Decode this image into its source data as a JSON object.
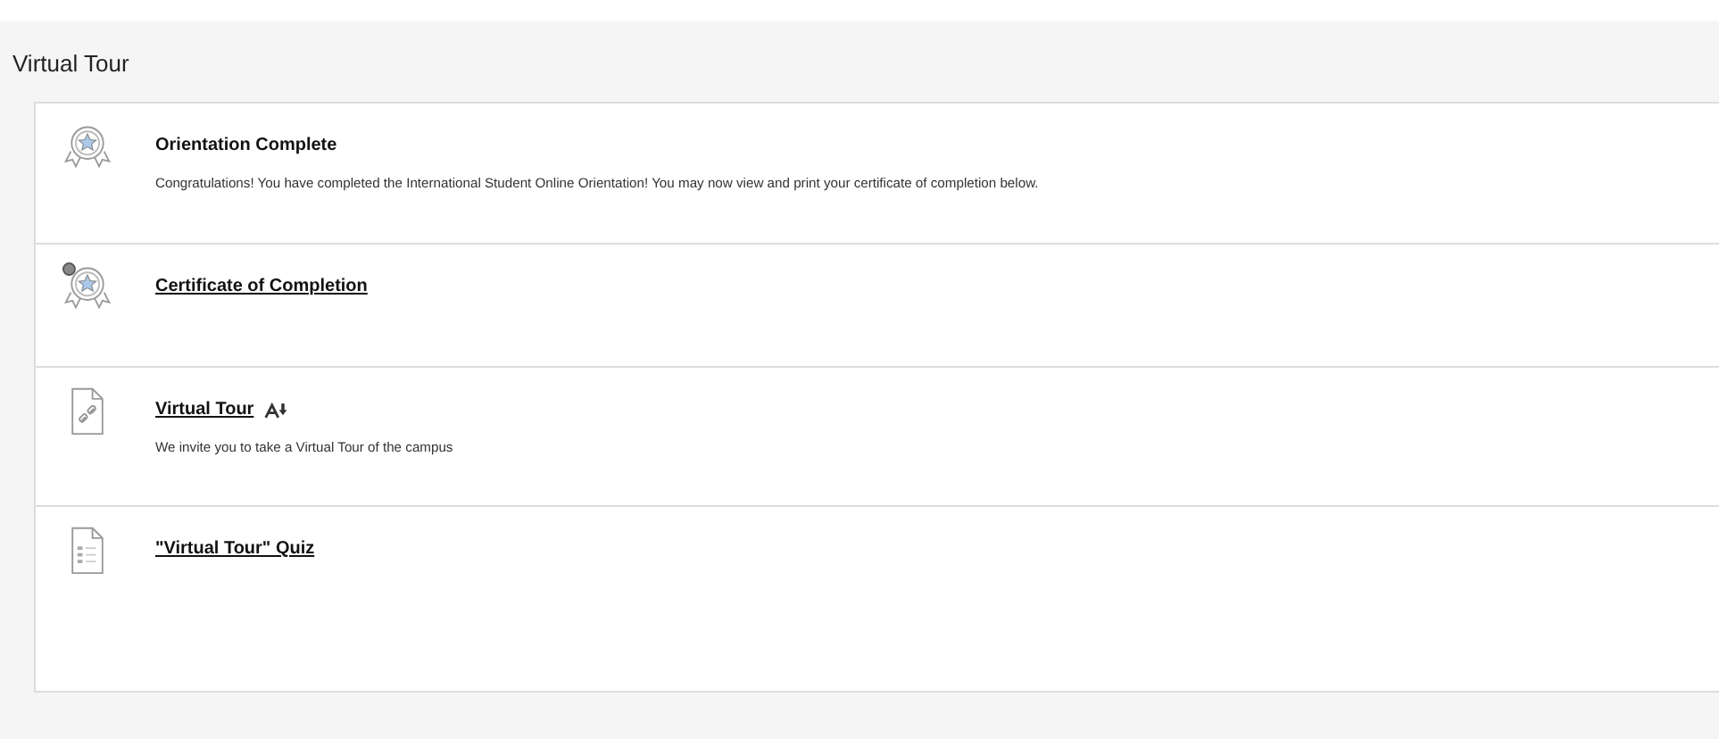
{
  "page": {
    "title": "Virtual Tour"
  },
  "items": [
    {
      "kind": "badge",
      "title": "Orientation Complete",
      "link": false,
      "adaptive_release": false,
      "description": "Congratulations! You have completed the International Student Online Orientation! You may now view and print your certificate of completion below."
    },
    {
      "kind": "certificate",
      "title": "Certificate of Completion",
      "link": true,
      "adaptive_release": false
    },
    {
      "kind": "weblink",
      "title": "Virtual Tour",
      "link": true,
      "adaptive_release": true,
      "description": "We invite you to take a Virtual Tour of the campus"
    },
    {
      "kind": "quiz",
      "title": "\"Virtual Tour\" Quiz",
      "link": true,
      "adaptive_release": false
    }
  ]
}
